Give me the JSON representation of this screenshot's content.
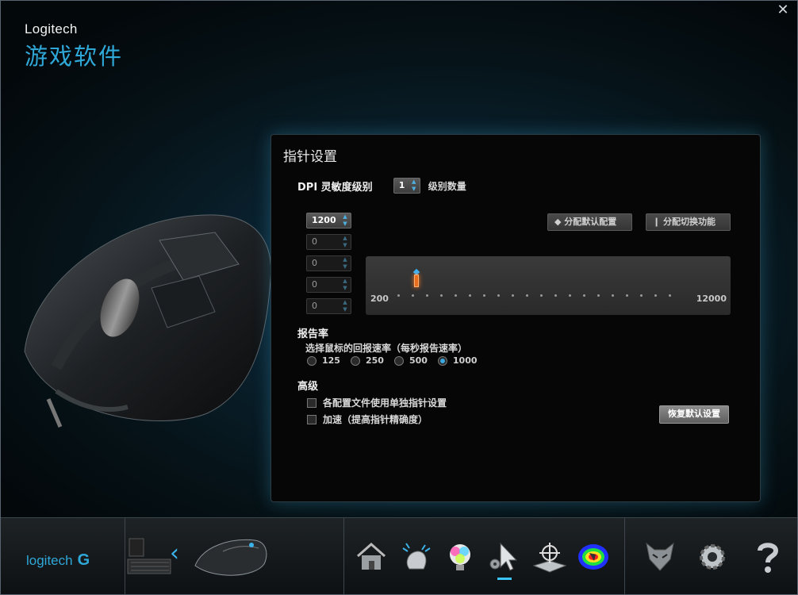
{
  "window": {
    "close_glyph": "✕"
  },
  "brand": {
    "company": "Logitech",
    "app_name": "游戏软件"
  },
  "panel": {
    "title": "指针设置",
    "dpi": {
      "label": "DPI 灵敏度级别",
      "levels_value": "1",
      "levels_label": "级别数量",
      "values": [
        "1200",
        "0",
        "0",
        "0",
        "0"
      ],
      "assign_default_label": "◆ 分配默认配置",
      "assign_switch_label": "❙ 分配切换功能",
      "slider_min": "200",
      "slider_max": "12000",
      "current": 1200
    },
    "report": {
      "title": "报告率",
      "subtitle": "选择鼠标的回报速率（每秒报告速率）",
      "rates": [
        "125",
        "250",
        "500",
        "1000"
      ],
      "selected": "1000"
    },
    "advanced": {
      "title": "高级",
      "option_per_profile": "各配置文件使用单独指针设置",
      "option_acceleration": "加速（提高指针精确度）",
      "restore_label": "恢复默认设置"
    }
  },
  "bottom": {
    "logo_text": "logitech",
    "logo_glyph": "G",
    "nav_arrow": "‹",
    "tools": [
      "home-icon",
      "customize-buttons-icon",
      "lighting-icon",
      "pointer-settings-icon",
      "surface-tuning-icon",
      "heatmap-icon",
      "profile-icon",
      "settings-icon",
      "help-icon"
    ],
    "active_tool": "pointer-settings-icon"
  },
  "colors": {
    "accent": "#2fa8d8",
    "marker": "#e86d1f",
    "active": "#3cc6ff"
  }
}
